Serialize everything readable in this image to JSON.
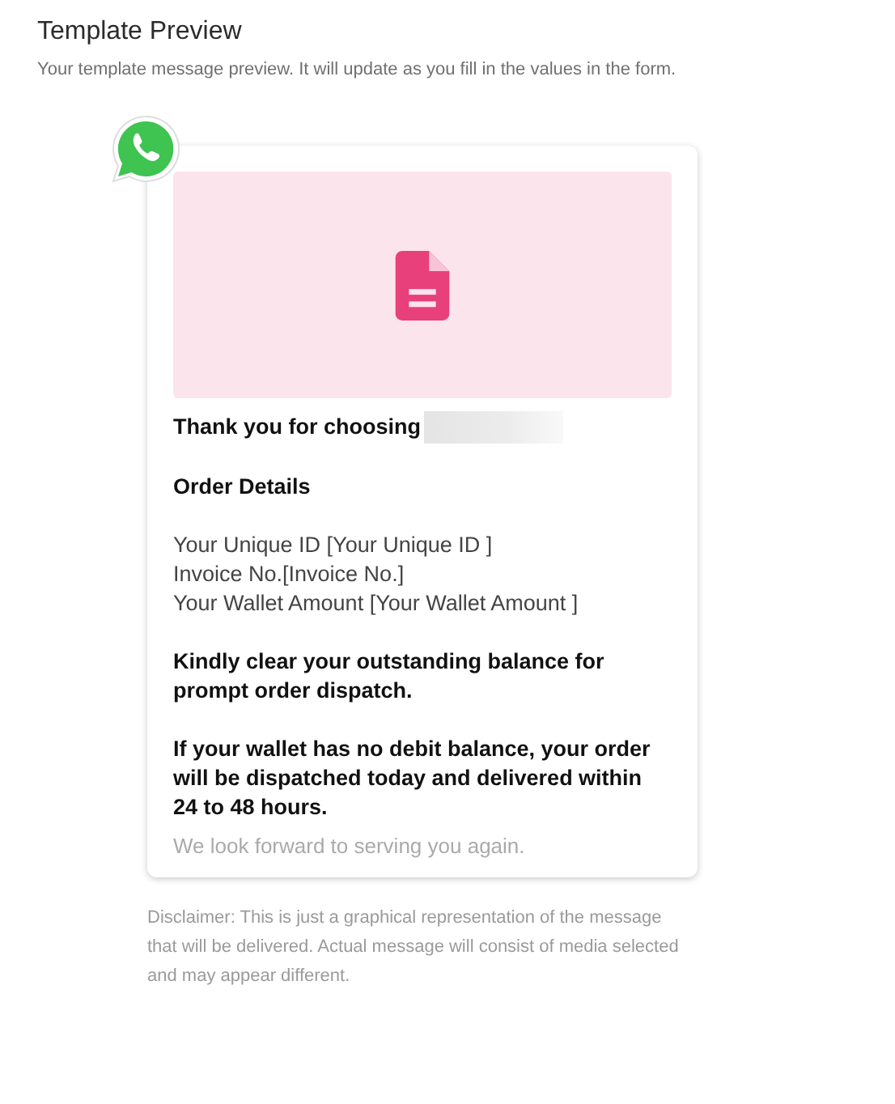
{
  "header": {
    "title": "Template Preview",
    "subtitle": "Your template message preview. It will update as you fill in the values in the form."
  },
  "message": {
    "media": {
      "kind": "document"
    },
    "blocks": [
      {
        "kind": "bold",
        "lines": [
          "Thank you for choosing"
        ],
        "redacted": true
      },
      {
        "kind": "bold",
        "lines": [
          "Order Details"
        ],
        "redacted": false
      },
      {
        "kind": "plain",
        "lines": [
          "Your Unique ID [Your Unique ID ]",
          "Invoice No.[Invoice No.]",
          "Your Wallet Amount [Your Wallet Amount ]"
        ],
        "redacted": false
      },
      {
        "kind": "bold",
        "lines": [
          "Kindly clear your outstanding balance for prompt order dispatch."
        ],
        "redacted": false
      },
      {
        "kind": "bold",
        "lines": [
          "If your wallet has no debit balance, your order will be dispatched today and delivered within 24 to 48 hours."
        ],
        "redacted": false
      }
    ],
    "footer": "We look forward to serving you again."
  },
  "disclaimer": "Disclaimer: This is just a graphical representation of the message that will be delivered. Actual message will consist of media selected and may appear different."
}
